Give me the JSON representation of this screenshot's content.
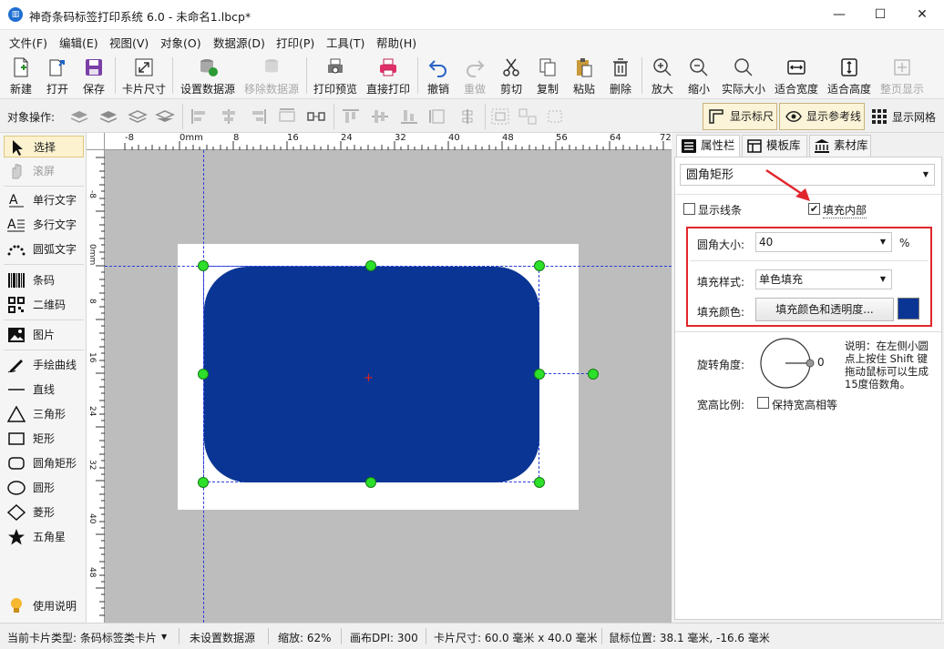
{
  "window": {
    "title": "神奇条码标签打印系统 6.0 - 未命名1.lbcp*"
  },
  "menu": [
    "文件(F)",
    "编辑(E)",
    "视图(V)",
    "对象(O)",
    "数据源(D)",
    "打印(P)",
    "工具(T)",
    "帮助(H)"
  ],
  "toolbar": {
    "new": "新建",
    "open": "打开",
    "save": "保存",
    "card_size": "卡片尺寸",
    "set_datasource": "设置数据源",
    "remove_datasource": "移除数据源",
    "print_preview": "打印预览",
    "direct_print": "直接打印",
    "undo": "撤销",
    "redo": "重做",
    "cut": "剪切",
    "copy": "复制",
    "paste": "粘贴",
    "delete": "删除",
    "zoom_in": "放大",
    "zoom_out": "缩小",
    "actual_size": "实际大小",
    "fit_width": "适合宽度",
    "fit_height": "适合高度",
    "fit_page": "整页显示"
  },
  "objbar": {
    "label": "对象操作:",
    "show_ruler": "显示标尺",
    "show_guides": "显示参考线",
    "show_grid": "显示网格"
  },
  "tools": {
    "select": "选择",
    "pan": "滚屏",
    "single_text": "单行文字",
    "multi_text": "多行文字",
    "arc_text": "圆弧文字",
    "barcode": "条码",
    "qrcode": "二维码",
    "image": "图片",
    "freehand": "手绘曲线",
    "line": "直线",
    "triangle": "三角形",
    "rect": "矩形",
    "round_rect": "圆角矩形",
    "ellipse": "圆形",
    "diamond": "菱形",
    "star": "五角星",
    "help": "使用说明"
  },
  "ruler": {
    "top": [
      "-8",
      "0mm",
      "8",
      "16",
      "24",
      "32",
      "40",
      "48",
      "56",
      "64",
      "72"
    ],
    "left": [
      "-8",
      "0mm",
      "8",
      "16",
      "24",
      "32",
      "40",
      "48"
    ]
  },
  "panel": {
    "tabs": [
      "属性栏",
      "模板库",
      "素材库"
    ],
    "object_type": "圆角矩形",
    "show_border": "显示线条",
    "fill_inside": "填充内部",
    "fill_checked": true,
    "corner_label": "圆角大小:",
    "corner_value": "40",
    "corner_unit": "%",
    "fill_style_label": "填充样式:",
    "fill_style_value": "单色填充",
    "fill_color_label": "填充颜色:",
    "fill_color_button": "填充颜色和透明度...",
    "fill_color": "#0a3594",
    "rotation_label": "旋转角度:",
    "rotation_value": "0",
    "rotation_note": "说明：在左侧小圆点上按住 Shift 键拖动鼠标可以生成15度倍数角。",
    "aspect_label": "宽高比例:",
    "aspect_keep": "保持宽高相等"
  },
  "status": {
    "card_type": "当前卡片类型: 条码标签类卡片",
    "datasource": "未设置数据源",
    "zoom": "缩放: 62%",
    "dpi": "画布DPI: 300",
    "card_size": "卡片尺寸: 60.0 毫米 x 40.0 毫米",
    "mouse": "鼠标位置: 38.1 毫米, -16.6 毫米"
  },
  "colors": {
    "shape_fill": "#0a3594",
    "handle": "#2de02a",
    "highlight_border": "#e0262b",
    "arrow": "#e0262b",
    "guide": "#2a3cd9"
  }
}
